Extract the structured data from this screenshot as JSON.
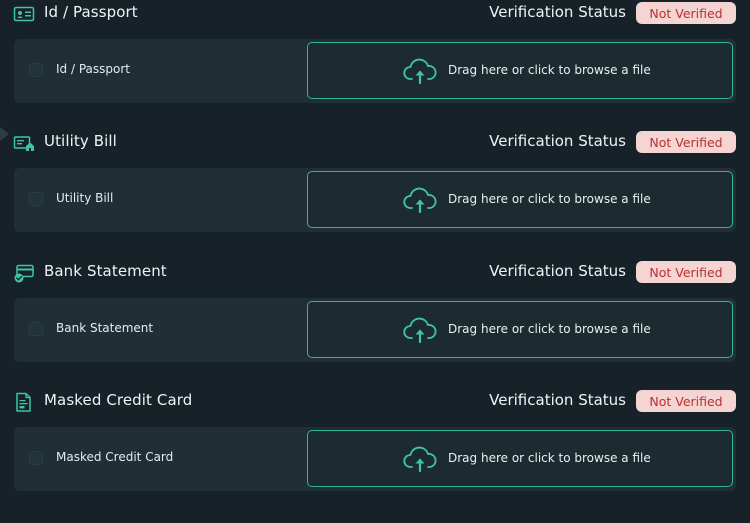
{
  "sections": [
    {
      "title": "Id / Passport",
      "icon": "id-card-icon",
      "status_label": "Verification Status",
      "status": "Not Verified",
      "card_label": "Id / Passport",
      "drop_text": "Drag here or click to browse a file"
    },
    {
      "title": "Utility Bill",
      "icon": "utility-bill-icon",
      "status_label": "Verification Status",
      "status": "Not Verified",
      "card_label": "Utility Bill",
      "drop_text": "Drag here or click to browse a file"
    },
    {
      "title": "Bank Statement",
      "icon": "bank-card-icon",
      "status_label": "Verification Status",
      "status": "Not Verified",
      "card_label": "Bank Statement",
      "drop_text": "Drag here or click to browse a file"
    },
    {
      "title": "Masked Credit Card",
      "icon": "document-icon",
      "status_label": "Verification Status",
      "status": "Not Verified",
      "card_label": "Masked Credit Card",
      "drop_text": "Drag here or click to browse a file"
    }
  ],
  "colors": {
    "background": "#172228",
    "card": "#1f2f35",
    "accent": "#2fb69a",
    "badge_bg": "#f5d4d4",
    "badge_text": "#b8322f"
  }
}
